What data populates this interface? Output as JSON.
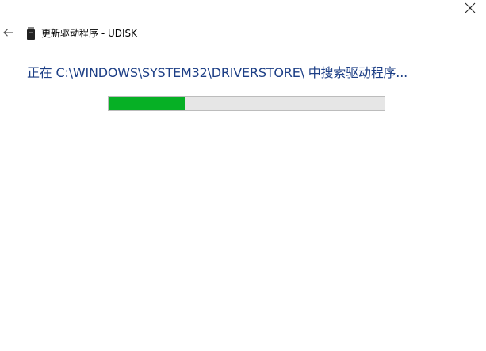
{
  "window": {
    "title": "更新驱动程序 - UDISK",
    "back_icon": "arrow-left-icon",
    "close_icon": "close-icon",
    "device_icon": "usb-drive-icon"
  },
  "status": {
    "text": "正在 C:\\WINDOWS\\SYSTEM32\\DRIVERSTORE\\ 中搜索驱动程序..."
  },
  "progress": {
    "value_fraction": 0.275,
    "fill_color": "#06b025",
    "track_color": "#e6e6e6"
  },
  "colors": {
    "status_text": "#1d3f86"
  }
}
